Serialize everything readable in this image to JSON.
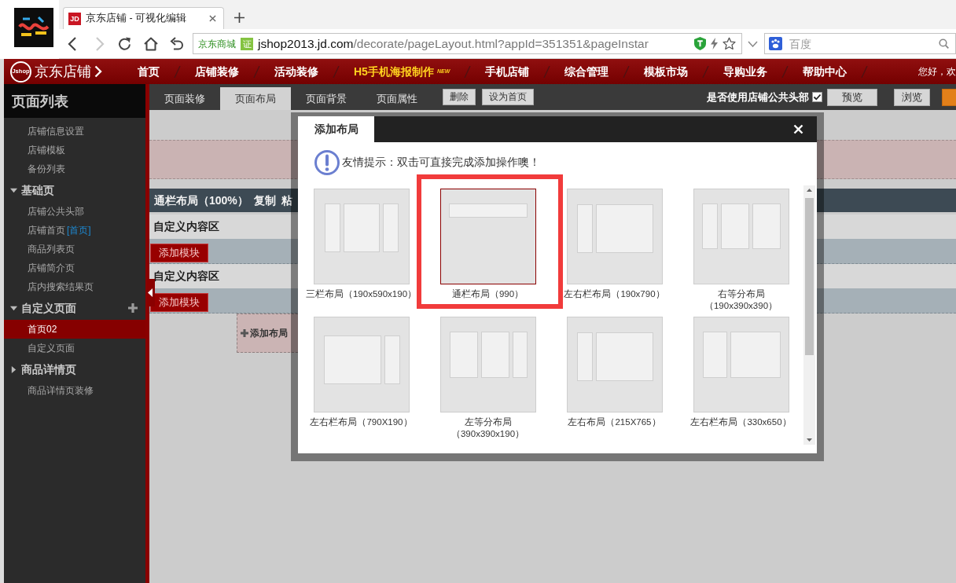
{
  "browser": {
    "tab": {
      "favicon": "JD",
      "title": "京东店铺 - 可视化编辑"
    },
    "nav_buttons": [
      {
        "kind": "back",
        "disabled": false
      },
      {
        "kind": "forward",
        "disabled": true
      },
      {
        "kind": "reload",
        "disabled": false
      },
      {
        "kind": "home",
        "disabled": false
      },
      {
        "kind": "undo",
        "disabled": false
      }
    ],
    "address": {
      "site_label": "京东商城",
      "badge": "证",
      "host": "jshop2013.jd.com",
      "path": "/decorate/pageLayout.html?appId=351351&pageInstar"
    },
    "search": {
      "placeholder": "百度"
    }
  },
  "topnav": {
    "logo_mark": "Jshop",
    "logo": "京东店铺",
    "items": [
      {
        "label": "首页",
        "highlight": false
      },
      {
        "label": "店铺装修",
        "highlight": false
      },
      {
        "label": "活动装修",
        "highlight": false
      },
      {
        "label": "H5手机海报制作",
        "highlight": true,
        "badge": "NEW"
      },
      {
        "label": "手机店铺",
        "highlight": false
      },
      {
        "label": "综合管理",
        "highlight": false
      },
      {
        "label": "模板市场",
        "highlight": false
      },
      {
        "label": "导购业务",
        "highlight": false
      },
      {
        "label": "帮助中心",
        "highlight": false
      }
    ],
    "greeting": "您好，欢"
  },
  "sidebar": {
    "title": "页面列表",
    "items": [
      {
        "kind": "page",
        "label": "店铺信息设置",
        "selected": false
      },
      {
        "kind": "page",
        "label": "店铺模板",
        "selected": false
      },
      {
        "kind": "page",
        "label": "备份列表",
        "selected": false
      },
      {
        "kind": "group",
        "label": "基础页",
        "selected": false,
        "expanded": true,
        "addable": false,
        "children": [
          {
            "kind": "page",
            "label": "店铺公共头部",
            "selected": false
          },
          {
            "kind": "page",
            "label": "店铺首页",
            "tag": "[首页]",
            "selected": false
          },
          {
            "kind": "page",
            "label": "商品列表页",
            "selected": false
          },
          {
            "kind": "page",
            "label": "店铺简介页",
            "selected": false
          },
          {
            "kind": "page",
            "label": "店内搜索结果页",
            "selected": false
          }
        ]
      },
      {
        "kind": "group",
        "label": "自定义页面",
        "selected": false,
        "expanded": true,
        "addable": true,
        "children": [
          {
            "kind": "page",
            "label": "首页02",
            "selected": true
          },
          {
            "kind": "page",
            "label": "自定义页面",
            "selected": false
          }
        ]
      },
      {
        "kind": "group",
        "label": "商品详情页",
        "selected": false,
        "expanded": false,
        "addable": false,
        "children": [
          {
            "kind": "page",
            "label": "商品详情页装修",
            "selected": false
          }
        ]
      }
    ]
  },
  "toolbar": {
    "tabs": [
      {
        "label": "页面装修",
        "selected": false
      },
      {
        "label": "页面布局",
        "selected": true
      },
      {
        "label": "页面背景",
        "selected": false
      },
      {
        "label": "页面属性",
        "selected": false
      }
    ],
    "actions": [
      "删除",
      "设为首页"
    ],
    "header_toggle": {
      "label": "是否使用店铺公共头部",
      "checked": true
    },
    "buttons": [
      {
        "kind": "plain",
        "label": "预览"
      },
      {
        "kind": "plain",
        "label": "浏览"
      },
      {
        "kind": "accent"
      }
    ]
  },
  "canvas": {
    "layout_bar": {
      "title": "通栏布局（100%）",
      "actions": [
        "复制",
        "粘"
      ]
    },
    "sections": [
      {
        "title": "自定义内容区",
        "button": "添加模块"
      },
      {
        "title": "自定义内容区",
        "button": "添加模块"
      }
    ],
    "add_layout": "添加布局"
  },
  "dialog": {
    "tab": "添加布局",
    "hint": "友情提示：双击可直接完成添加操作噢！",
    "layouts": [
      {
        "kind": "three-column",
        "caption": "三栏布局（190x590x190）",
        "selected": false,
        "highlighted": false
      },
      {
        "kind": "full-width",
        "caption": "通栏布局（990）",
        "selected": true,
        "highlighted": true
      },
      {
        "kind": "narrow-wide",
        "caption": "左右栏布局（190x790）",
        "selected": false,
        "highlighted": false
      },
      {
        "kind": "narrow-two-equal",
        "caption": "右等分布局（190x390x390）",
        "selected": false,
        "highlighted": false
      },
      {
        "kind": "wide-narrow",
        "caption": "左右栏布局（790X190）",
        "selected": false,
        "highlighted": false
      },
      {
        "kind": "two-equal-narrow",
        "caption": "左等分布局（390x390x190）",
        "selected": false,
        "highlighted": false
      },
      {
        "kind": "narrow-wide",
        "caption": "左右布局（215X765）",
        "selected": false,
        "highlighted": false
      },
      {
        "kind": "medium-wide",
        "caption": "左右栏布局（330x650）",
        "selected": false,
        "highlighted": false
      }
    ]
  }
}
